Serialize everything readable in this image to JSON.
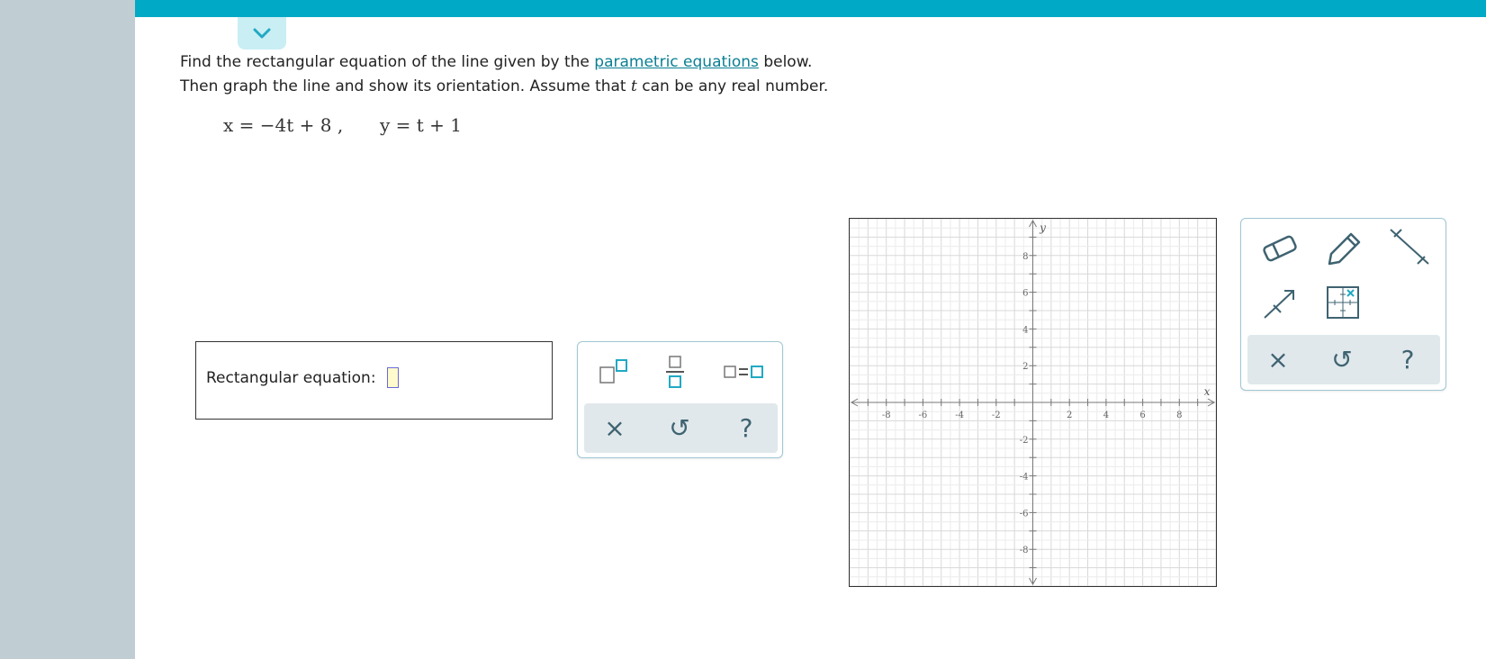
{
  "problem": {
    "line1_before_link": "Find the rectangular equation of the line given by the ",
    "link_text": "parametric equations",
    "line1_after_link": " below.",
    "line2_before_var": "Then graph the line and show its orientation. Assume that ",
    "variable": "t",
    "line2_after_var": " can be any real number."
  },
  "equations": {
    "x_equation": "x = −4t + 8 ,",
    "y_equation": "y = t + 1"
  },
  "answer": {
    "label": "Rectangular equation:",
    "value": ""
  },
  "math_palette": {
    "buttons": [
      "superscript-template",
      "fraction-template",
      "equation-template"
    ],
    "actions": {
      "clear": "×",
      "undo": "↺",
      "help": "?"
    }
  },
  "graph": {
    "x_axis_label": "x",
    "y_axis_label": "y",
    "x_range": [
      -10,
      10
    ],
    "y_range": [
      -10,
      10
    ],
    "x_tick_labels": [
      "-8",
      "-6",
      "-4",
      "-2",
      "2",
      "4",
      "6",
      "8"
    ],
    "y_tick_labels": [
      "8",
      "6",
      "4",
      "2",
      "-2",
      "-4",
      "-6",
      "-8"
    ],
    "grid": true
  },
  "graph_toolbar": {
    "tools": [
      "eraser-icon",
      "pencil-icon",
      "line-icon",
      "ray-icon",
      "grid-settings-icon"
    ],
    "actions": {
      "clear": "×",
      "undo": "↺",
      "help": "?"
    }
  },
  "colors": {
    "header": "#00a9c6",
    "sidebar": "#c0ced3",
    "link": "#0a7f93",
    "icon": "#3f6371",
    "accent": "#21a9c4"
  }
}
